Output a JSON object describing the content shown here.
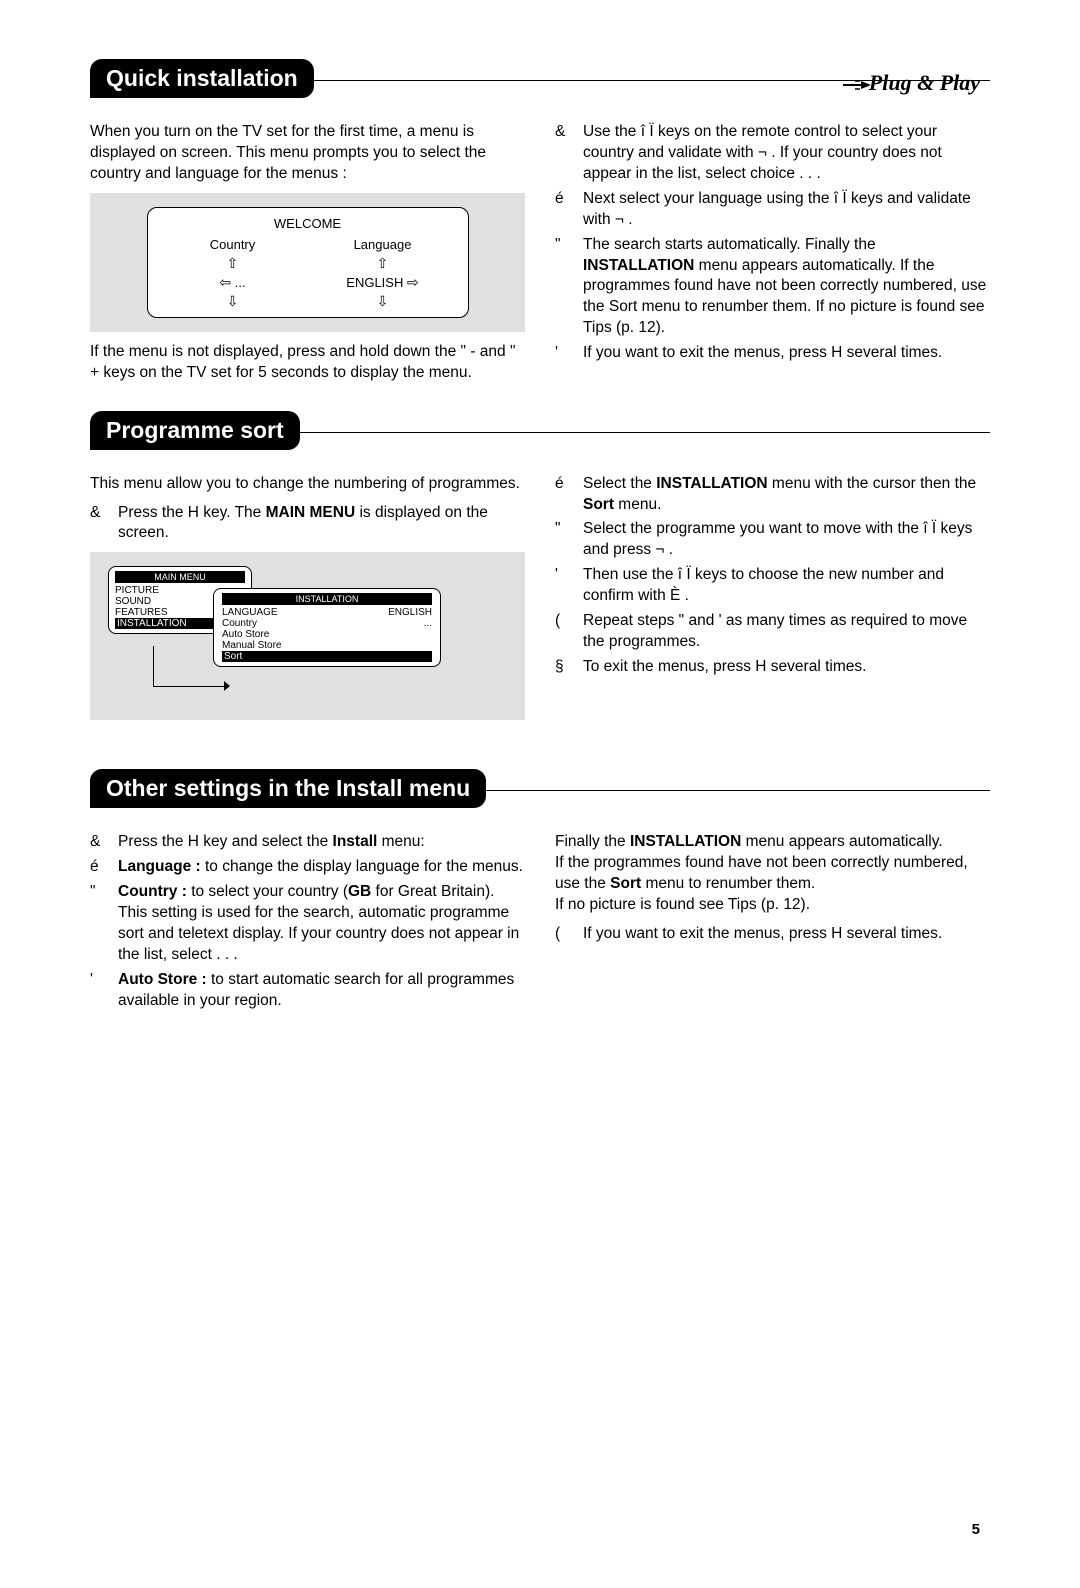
{
  "logo_text": "Plug & Play",
  "page_number": "5",
  "section1": {
    "heading": "Quick installation",
    "intro": "When you turn on the TV set for the first time, a menu is displayed on screen. This menu prompts you to select the country and language for the menus :",
    "welcome": {
      "title": "WELCOME",
      "col1_label": "Country",
      "col1_value": "...",
      "col2_label": "Language",
      "col2_value": "ENGLISH"
    },
    "note": "If the menu is not displayed, press and hold down the \"  - and \"  + keys on the TV set for 5 seconds to display the menu.",
    "steps": [
      {
        "marker": "&",
        "text": "Use the î  Ï   keys on the remote control to select your country and validate with ¬ . If your country does not appear in the list, select choice  . . ."
      },
      {
        "marker": "é",
        "text": "Next select your language using the î  Ï keys and validate with ¬  ."
      },
      {
        "marker": "\"",
        "text": "The search starts automatically. Finally the <b>INSTALLATION</b> menu appears automatically. If the programmes found have not been correctly numbered, use the Sort menu to renumber them. If no picture is found see Tips (p. 12)."
      },
      {
        "marker": "'",
        "text": "If you want to exit the menus, press H several times."
      }
    ]
  },
  "section2": {
    "heading": "Programme sort",
    "intro": "This menu allow you to change the numbering of programmes.",
    "left_steps": [
      {
        "marker": "&",
        "text": "Press the H  key. The <b>MAIN MENU</b> is displayed on the screen."
      }
    ],
    "menu1": {
      "title": "MAIN MENU",
      "items": [
        "PICTURE",
        "SOUND",
        "FEATURES"
      ],
      "highlight": "INSTALLATION"
    },
    "menu2": {
      "title": "INSTALLATION",
      "rows": [
        {
          "label": "LANGUAGE",
          "value": "ENGLISH"
        },
        {
          "label": "Country",
          "value": "..."
        },
        {
          "label": "Auto Store",
          "value": ""
        },
        {
          "label": "Manual Store",
          "value": ""
        }
      ],
      "highlight": "Sort"
    },
    "right_steps": [
      {
        "marker": "é",
        "text": "Select the <b>INSTALLATION</b> menu with the cursor then the <b>Sort</b> menu."
      },
      {
        "marker": "\"",
        "text": "Select the programme you want to move with the î  Ï   keys and press ¬ ."
      },
      {
        "marker": "'",
        "text": "Then use the î  Ï   keys to choose the new number and confirm with È  ."
      },
      {
        "marker": "(",
        "text": "Repeat steps \"  and '  as many times as required to move the programmes."
      },
      {
        "marker": "§",
        "text": "To exit the menus, press H  several times."
      }
    ]
  },
  "section3": {
    "heading": "Other settings in the Install menu",
    "left_steps": [
      {
        "marker": "&",
        "text": "Press the H  key and select the <b>Install</b> menu:"
      },
      {
        "marker": "é",
        "text": "<b>Language :</b> to change the display language for the menus."
      },
      {
        "marker": "\"",
        "text": "<b>Country :</b> to select your country (<b>GB</b> for Great Britain). This setting is used for the search, automatic programme sort and teletext display. If your country does not appear in the list, select  . . ."
      },
      {
        "marker": "'",
        "text": "<b>Auto Store :</b> to start automatic search for all programmes available in your region."
      }
    ],
    "right_text": "Finally the <b>INSTALLATION</b> menu appears automatically.<br>If the programmes found have not been correctly numbered, use the <b>Sort</b> menu to renumber them.<br>If no picture is found see Tips (p. 12).",
    "right_steps": [
      {
        "marker": "(",
        "text": "If you want to exit the menus, press H several times."
      }
    ]
  }
}
